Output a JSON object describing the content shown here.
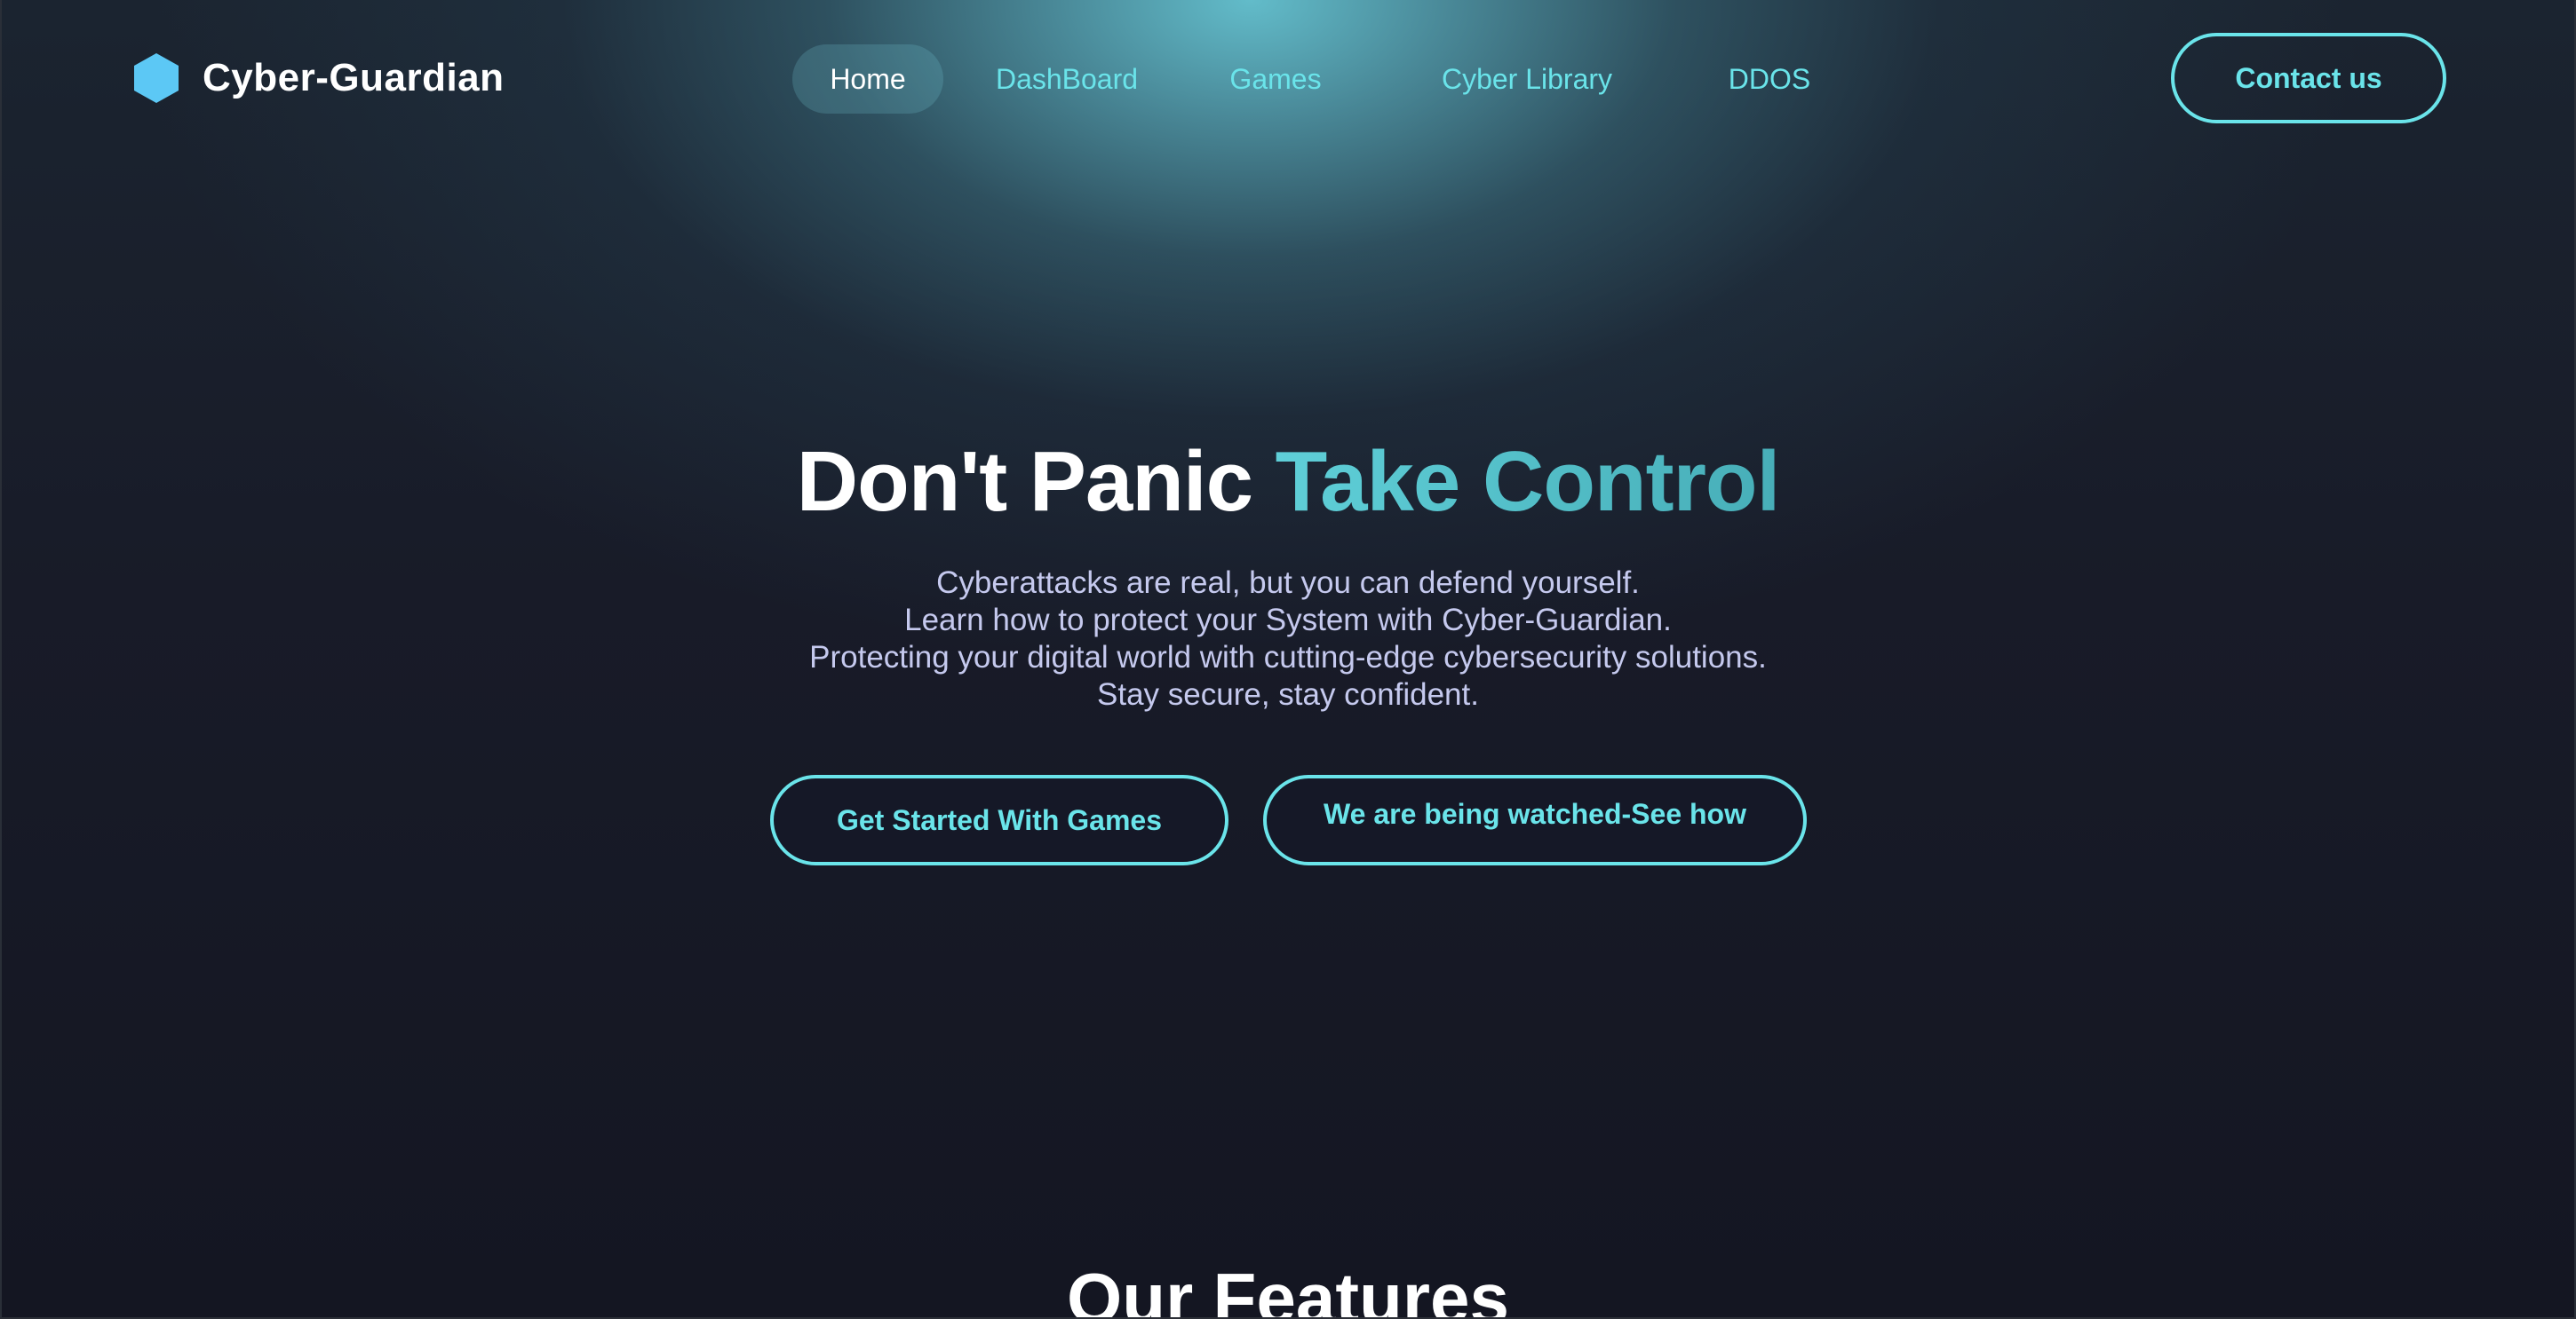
{
  "brand": {
    "name": "Cyber-Guardian",
    "icon": "hexagon-logo-icon",
    "icon_color": "#5cc8f5"
  },
  "nav": {
    "items": [
      {
        "label": "Home",
        "active": true
      },
      {
        "label": "DashBoard",
        "active": false
      },
      {
        "label": "Games",
        "active": false
      },
      {
        "label": "Cyber Library",
        "active": false
      },
      {
        "label": "DDOS",
        "active": false
      }
    ],
    "contact_label": "Contact us"
  },
  "hero": {
    "title_part1": "Don't Panic",
    "title_part2": "Take Control",
    "lines": [
      "Cyberattacks are real, but you can defend yourself.",
      "Learn how to protect your System with Cyber-Guardian.",
      "Protecting your digital world with cutting-edge cybersecurity solutions.",
      "Stay secure, stay confident."
    ],
    "primary_button": "Get Started With Games",
    "secondary_button": "We are being watched-See how"
  },
  "features": {
    "title": "Our Features"
  },
  "colors": {
    "accent": "#6ae4ea",
    "title_accent": "#54c4cc",
    "background": "#14141e",
    "body_text": "#c5c9ee"
  }
}
